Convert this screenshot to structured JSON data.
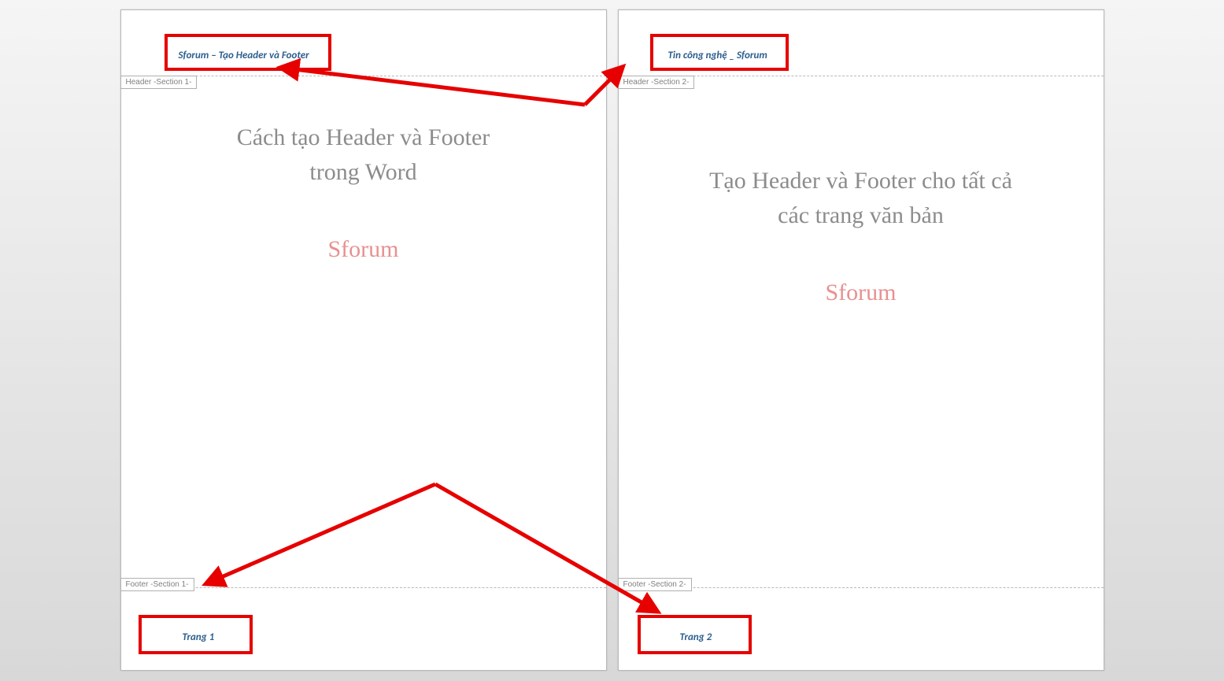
{
  "pages": [
    {
      "header_tag": "Header -Section 1-",
      "footer_tag": "Footer -Section 1-",
      "header_text": "Sforum – Tạo Header và Footer",
      "footer_text": "Trang 1",
      "heading_l1": "Cách tạo Header và Footer",
      "heading_l2": "trong Word",
      "brand": "Sforum"
    },
    {
      "header_tag": "Header -Section 2-",
      "footer_tag": "Footer -Section 2-",
      "header_text": "Tin công nghệ _ Sforum",
      "footer_text": "Trang 2",
      "heading_l1": "Tạo Header và Footer cho tất cả",
      "heading_l2": "các trang văn bản",
      "brand": "Sforum"
    }
  ]
}
